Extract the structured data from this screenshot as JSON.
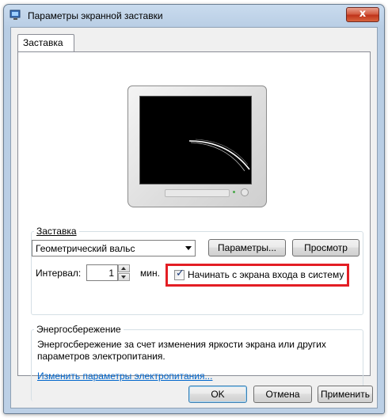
{
  "window": {
    "title": "Параметры экранной заставки",
    "close_label": "x"
  },
  "tabs": [
    {
      "label": "Заставка",
      "selected": true
    }
  ],
  "screensaver_group": {
    "label": "Заставка",
    "selected": "Геометрический вальс",
    "settings_button": "Параметры...",
    "preview_button": "Просмотр",
    "interval_label": "Интервал:",
    "interval_value": "1",
    "interval_unit": "мин.",
    "resume_checkbox": {
      "label": "Начинать с экрана входа в систему",
      "checked": true
    }
  },
  "power_group": {
    "label": "Энергосбережение",
    "description_line1": "Энергосбережение за счет изменения яркости экрана или других",
    "description_line2": "параметров электропитания.",
    "link": "Изменить параметры электропитания..."
  },
  "footer": {
    "ok": "OK",
    "cancel": "Отмена",
    "apply": "Применить"
  },
  "colors": {
    "highlight": "#e31e24",
    "link": "#0066cc"
  }
}
